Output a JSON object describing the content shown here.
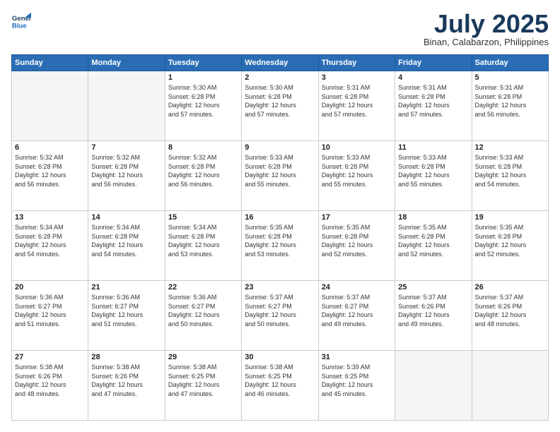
{
  "header": {
    "logo_line1": "General",
    "logo_line2": "Blue",
    "month": "July 2025",
    "location": "Binan, Calabarzon, Philippines"
  },
  "weekdays": [
    "Sunday",
    "Monday",
    "Tuesday",
    "Wednesday",
    "Thursday",
    "Friday",
    "Saturday"
  ],
  "weeks": [
    [
      {
        "day": "",
        "info": ""
      },
      {
        "day": "",
        "info": ""
      },
      {
        "day": "1",
        "info": "Sunrise: 5:30 AM\nSunset: 6:28 PM\nDaylight: 12 hours\nand 57 minutes."
      },
      {
        "day": "2",
        "info": "Sunrise: 5:30 AM\nSunset: 6:28 PM\nDaylight: 12 hours\nand 57 minutes."
      },
      {
        "day": "3",
        "info": "Sunrise: 5:31 AM\nSunset: 6:28 PM\nDaylight: 12 hours\nand 57 minutes."
      },
      {
        "day": "4",
        "info": "Sunrise: 5:31 AM\nSunset: 6:28 PM\nDaylight: 12 hours\nand 57 minutes."
      },
      {
        "day": "5",
        "info": "Sunrise: 5:31 AM\nSunset: 6:28 PM\nDaylight: 12 hours\nand 56 minutes."
      }
    ],
    [
      {
        "day": "6",
        "info": "Sunrise: 5:32 AM\nSunset: 6:28 PM\nDaylight: 12 hours\nand 56 minutes."
      },
      {
        "day": "7",
        "info": "Sunrise: 5:32 AM\nSunset: 6:28 PM\nDaylight: 12 hours\nand 56 minutes."
      },
      {
        "day": "8",
        "info": "Sunrise: 5:32 AM\nSunset: 6:28 PM\nDaylight: 12 hours\nand 56 minutes."
      },
      {
        "day": "9",
        "info": "Sunrise: 5:33 AM\nSunset: 6:28 PM\nDaylight: 12 hours\nand 55 minutes."
      },
      {
        "day": "10",
        "info": "Sunrise: 5:33 AM\nSunset: 6:28 PM\nDaylight: 12 hours\nand 55 minutes."
      },
      {
        "day": "11",
        "info": "Sunrise: 5:33 AM\nSunset: 6:28 PM\nDaylight: 12 hours\nand 55 minutes."
      },
      {
        "day": "12",
        "info": "Sunrise: 5:33 AM\nSunset: 6:28 PM\nDaylight: 12 hours\nand 54 minutes."
      }
    ],
    [
      {
        "day": "13",
        "info": "Sunrise: 5:34 AM\nSunset: 6:28 PM\nDaylight: 12 hours\nand 54 minutes."
      },
      {
        "day": "14",
        "info": "Sunrise: 5:34 AM\nSunset: 6:28 PM\nDaylight: 12 hours\nand 54 minutes."
      },
      {
        "day": "15",
        "info": "Sunrise: 5:34 AM\nSunset: 6:28 PM\nDaylight: 12 hours\nand 53 minutes."
      },
      {
        "day": "16",
        "info": "Sunrise: 5:35 AM\nSunset: 6:28 PM\nDaylight: 12 hours\nand 53 minutes."
      },
      {
        "day": "17",
        "info": "Sunrise: 5:35 AM\nSunset: 6:28 PM\nDaylight: 12 hours\nand 52 minutes."
      },
      {
        "day": "18",
        "info": "Sunrise: 5:35 AM\nSunset: 6:28 PM\nDaylight: 12 hours\nand 52 minutes."
      },
      {
        "day": "19",
        "info": "Sunrise: 5:35 AM\nSunset: 6:28 PM\nDaylight: 12 hours\nand 52 minutes."
      }
    ],
    [
      {
        "day": "20",
        "info": "Sunrise: 5:36 AM\nSunset: 6:27 PM\nDaylight: 12 hours\nand 51 minutes."
      },
      {
        "day": "21",
        "info": "Sunrise: 5:36 AM\nSunset: 6:27 PM\nDaylight: 12 hours\nand 51 minutes."
      },
      {
        "day": "22",
        "info": "Sunrise: 5:36 AM\nSunset: 6:27 PM\nDaylight: 12 hours\nand 50 minutes."
      },
      {
        "day": "23",
        "info": "Sunrise: 5:37 AM\nSunset: 6:27 PM\nDaylight: 12 hours\nand 50 minutes."
      },
      {
        "day": "24",
        "info": "Sunrise: 5:37 AM\nSunset: 6:27 PM\nDaylight: 12 hours\nand 49 minutes."
      },
      {
        "day": "25",
        "info": "Sunrise: 5:37 AM\nSunset: 6:26 PM\nDaylight: 12 hours\nand 49 minutes."
      },
      {
        "day": "26",
        "info": "Sunrise: 5:37 AM\nSunset: 6:26 PM\nDaylight: 12 hours\nand 48 minutes."
      }
    ],
    [
      {
        "day": "27",
        "info": "Sunrise: 5:38 AM\nSunset: 6:26 PM\nDaylight: 12 hours\nand 48 minutes."
      },
      {
        "day": "28",
        "info": "Sunrise: 5:38 AM\nSunset: 6:26 PM\nDaylight: 12 hours\nand 47 minutes."
      },
      {
        "day": "29",
        "info": "Sunrise: 5:38 AM\nSunset: 6:25 PM\nDaylight: 12 hours\nand 47 minutes."
      },
      {
        "day": "30",
        "info": "Sunrise: 5:38 AM\nSunset: 6:25 PM\nDaylight: 12 hours\nand 46 minutes."
      },
      {
        "day": "31",
        "info": "Sunrise: 5:39 AM\nSunset: 6:25 PM\nDaylight: 12 hours\nand 45 minutes."
      },
      {
        "day": "",
        "info": ""
      },
      {
        "day": "",
        "info": ""
      }
    ]
  ]
}
